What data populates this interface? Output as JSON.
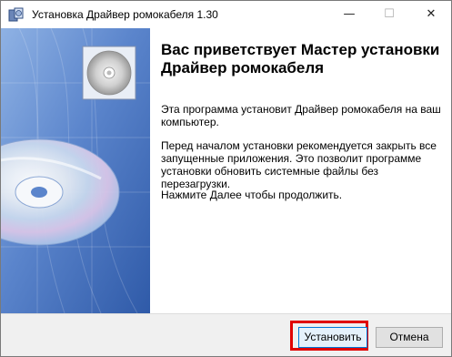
{
  "window": {
    "title": "Установка Драйвер ромокабеля 1.30",
    "minimize_glyph": "—",
    "maximize_glyph": "☐",
    "close_glyph": "✕"
  },
  "main": {
    "heading": "Вас приветствует Мастер установки Драйвер ромокабеля",
    "paragraph1": "Эта программа установит Драйвер ромокабеля на ваш компьютер.",
    "paragraph2": "Перед началом установки рекомендуется закрыть все запущенные приложения. Это позволит программе установки обновить системные файлы без перезагрузки.",
    "paragraph3": "Нажмите Далее чтобы продолжить."
  },
  "footer": {
    "install_label": "Установить",
    "cancel_label": "Отмена"
  },
  "icons": {
    "app": "installer-icon",
    "banner": "cd-disc-icon"
  },
  "colors": {
    "banner_blue": "#4d77c4",
    "highlight_red": "#e00000",
    "focus_blue": "#0078d7"
  }
}
